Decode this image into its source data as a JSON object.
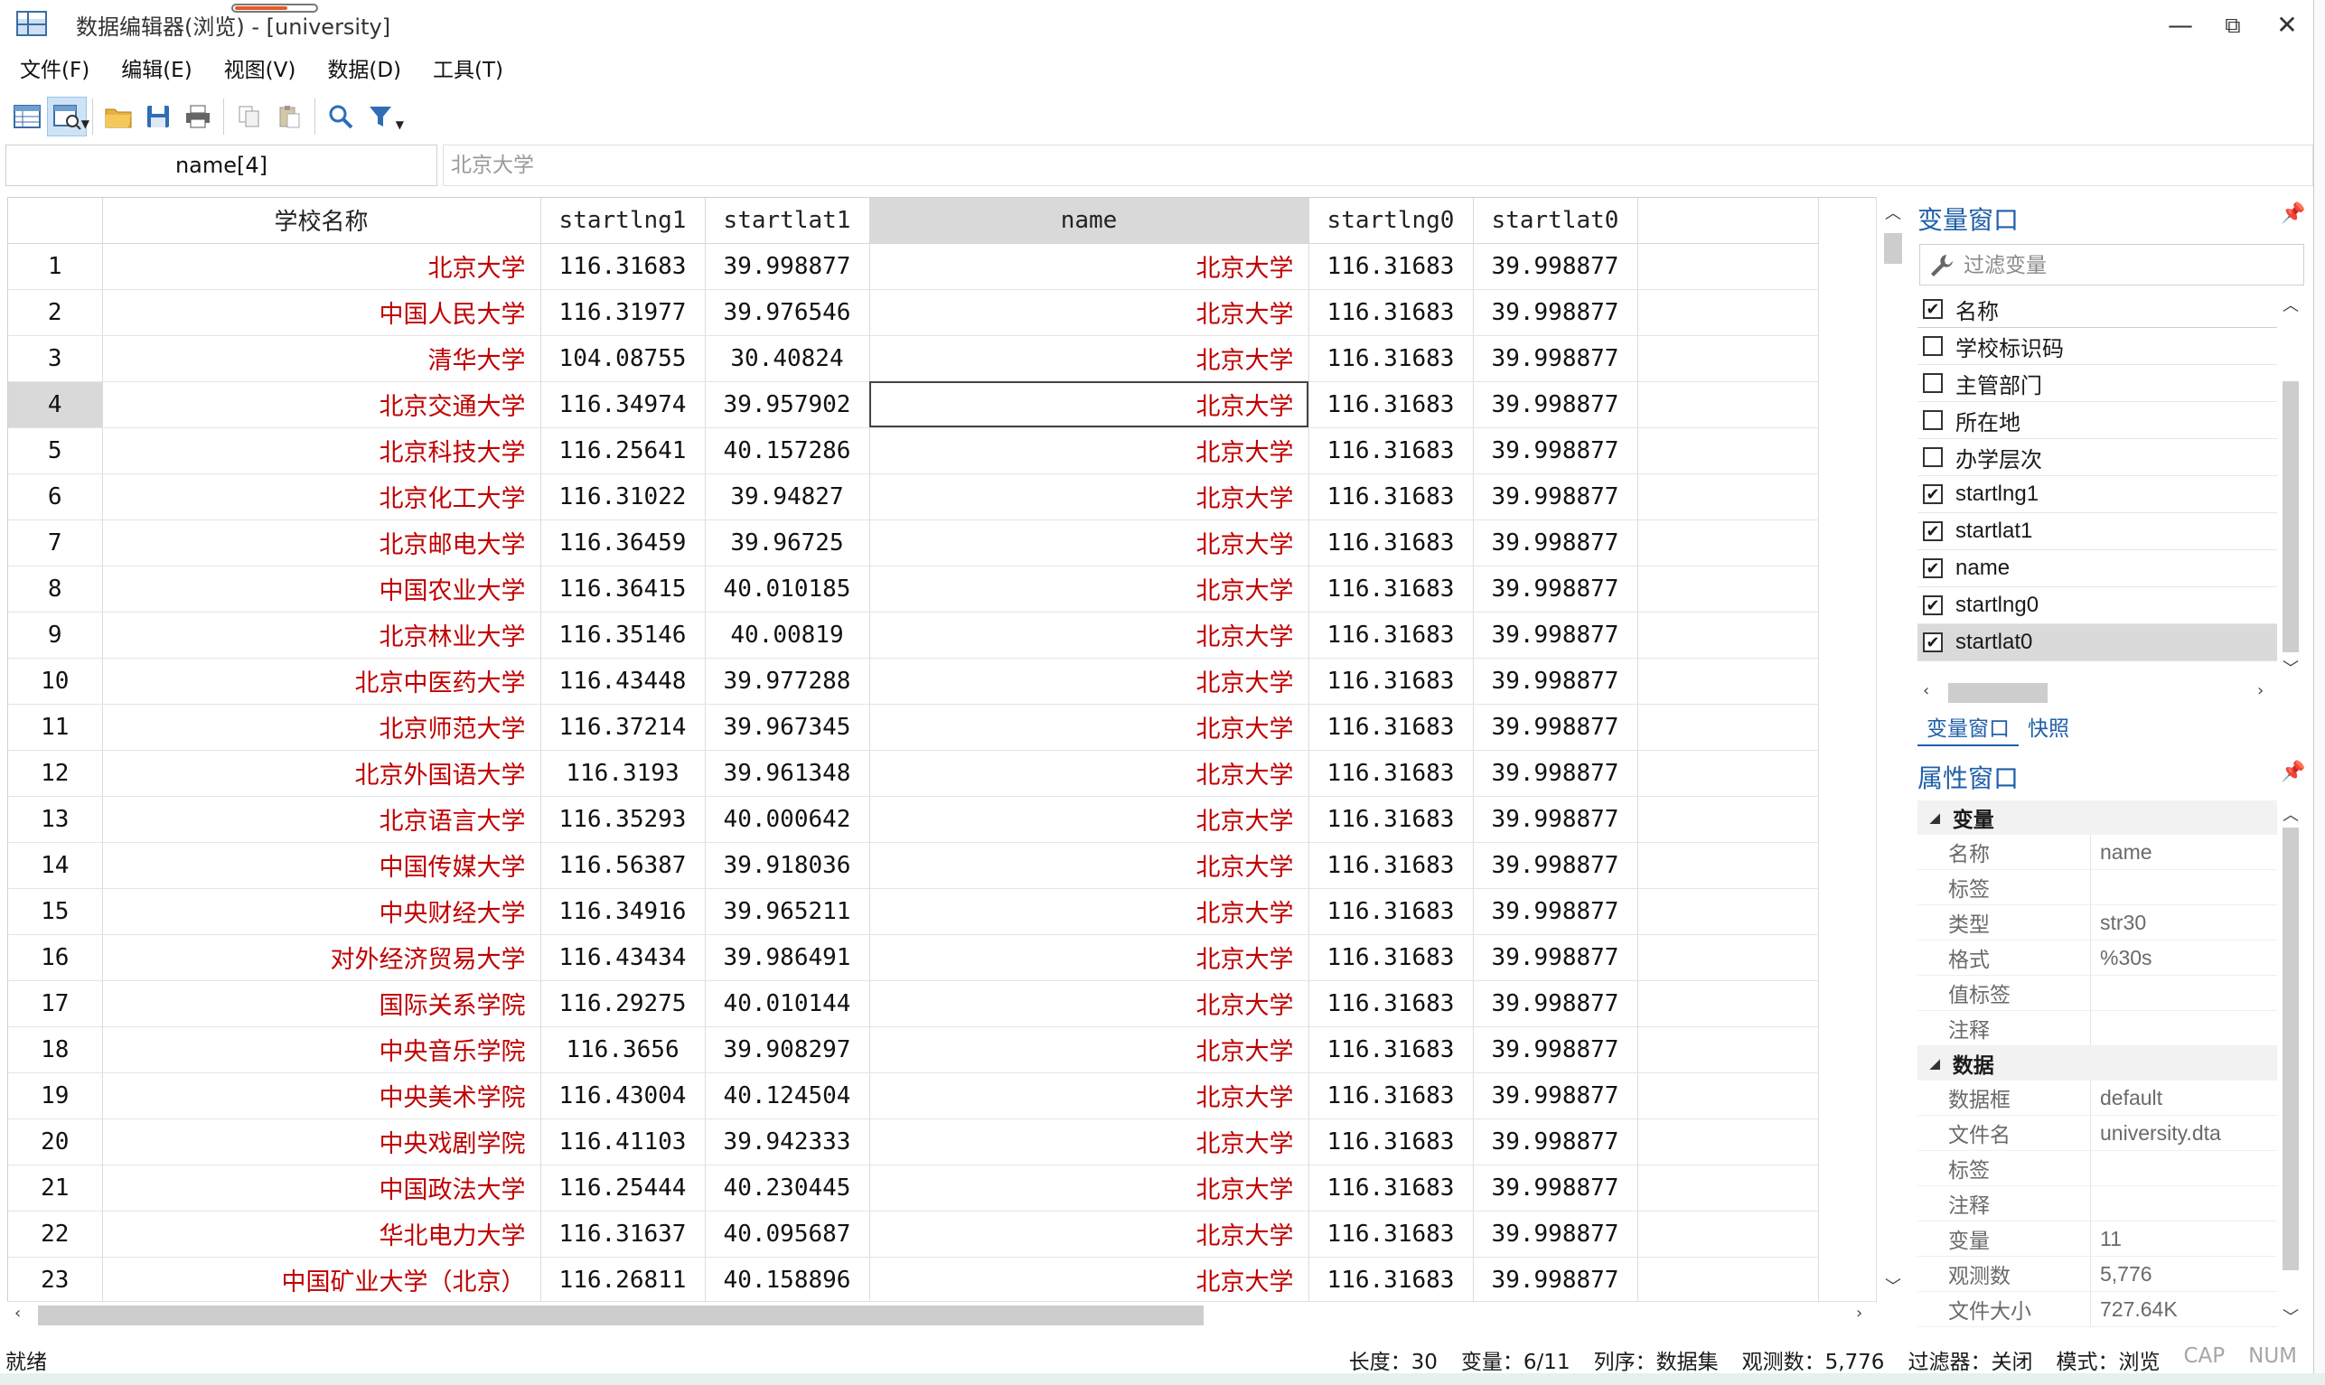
{
  "window": {
    "title": "数据编辑器(浏览) - [university]",
    "minimize": "—",
    "restore": "⧉",
    "close": "✕"
  },
  "menu": [
    "文件(F)",
    "编辑(E)",
    "视图(V)",
    "数据(D)",
    "工具(T)"
  ],
  "toolbar": {
    "icons": [
      "data-editor-edit-icon",
      "data-editor-browse-icon",
      "open-folder-icon",
      "save-icon",
      "print-icon",
      "copy-icon",
      "paste-icon",
      "search-icon",
      "filter-icon"
    ],
    "active": "data-editor-browse-icon"
  },
  "entry": {
    "var_ref": "name[4]",
    "value": "北京大学"
  },
  "grid": {
    "columns": [
      "",
      "学校名称",
      "startlng1",
      "startlat1",
      "name",
      "startlng0",
      "startlat0",
      ""
    ],
    "selected_column": "name",
    "current_row": 4,
    "rows": [
      [
        "1",
        "北京大学",
        "116.31683",
        "39.998877",
        "北京大学",
        "116.31683",
        "39.998877"
      ],
      [
        "2",
        "中国人民大学",
        "116.31977",
        "39.976546",
        "北京大学",
        "116.31683",
        "39.998877"
      ],
      [
        "3",
        "清华大学",
        "104.08755",
        "30.40824",
        "北京大学",
        "116.31683",
        "39.998877"
      ],
      [
        "4",
        "北京交通大学",
        "116.34974",
        "39.957902",
        "北京大学",
        "116.31683",
        "39.998877"
      ],
      [
        "5",
        "北京科技大学",
        "116.25641",
        "40.157286",
        "北京大学",
        "116.31683",
        "39.998877"
      ],
      [
        "6",
        "北京化工大学",
        "116.31022",
        "39.94827",
        "北京大学",
        "116.31683",
        "39.998877"
      ],
      [
        "7",
        "北京邮电大学",
        "116.36459",
        "39.96725",
        "北京大学",
        "116.31683",
        "39.998877"
      ],
      [
        "8",
        "中国农业大学",
        "116.36415",
        "40.010185",
        "北京大学",
        "116.31683",
        "39.998877"
      ],
      [
        "9",
        "北京林业大学",
        "116.35146",
        "40.00819",
        "北京大学",
        "116.31683",
        "39.998877"
      ],
      [
        "10",
        "北京中医药大学",
        "116.43448",
        "39.977288",
        "北京大学",
        "116.31683",
        "39.998877"
      ],
      [
        "11",
        "北京师范大学",
        "116.37214",
        "39.967345",
        "北京大学",
        "116.31683",
        "39.998877"
      ],
      [
        "12",
        "北京外国语大学",
        "116.3193",
        "39.961348",
        "北京大学",
        "116.31683",
        "39.998877"
      ],
      [
        "13",
        "北京语言大学",
        "116.35293",
        "40.000642",
        "北京大学",
        "116.31683",
        "39.998877"
      ],
      [
        "14",
        "中国传媒大学",
        "116.56387",
        "39.918036",
        "北京大学",
        "116.31683",
        "39.998877"
      ],
      [
        "15",
        "中央财经大学",
        "116.34916",
        "39.965211",
        "北京大学",
        "116.31683",
        "39.998877"
      ],
      [
        "16",
        "对外经济贸易大学",
        "116.43434",
        "39.986491",
        "北京大学",
        "116.31683",
        "39.998877"
      ],
      [
        "17",
        "国际关系学院",
        "116.29275",
        "40.010144",
        "北京大学",
        "116.31683",
        "39.998877"
      ],
      [
        "18",
        "中央音乐学院",
        "116.3656",
        "39.908297",
        "北京大学",
        "116.31683",
        "39.998877"
      ],
      [
        "19",
        "中央美术学院",
        "116.43004",
        "40.124504",
        "北京大学",
        "116.31683",
        "39.998877"
      ],
      [
        "20",
        "中央戏剧学院",
        "116.41103",
        "39.942333",
        "北京大学",
        "116.31683",
        "39.998877"
      ],
      [
        "21",
        "中国政法大学",
        "116.25444",
        "40.230445",
        "北京大学",
        "116.31683",
        "39.998877"
      ],
      [
        "22",
        "华北电力大学",
        "116.31637",
        "40.095687",
        "北京大学",
        "116.31683",
        "39.998877"
      ],
      [
        "23",
        "中国矿业大学（北京）",
        "116.26811",
        "40.158896",
        "北京大学",
        "116.31683",
        "39.998877"
      ]
    ]
  },
  "variables_panel": {
    "title": "变量窗口",
    "filter_placeholder": "过滤变量",
    "header": "名称",
    "items": [
      {
        "name": "学校标识码",
        "checked": false
      },
      {
        "name": "主管部门",
        "checked": false
      },
      {
        "name": "所在地",
        "checked": false
      },
      {
        "name": "办学层次",
        "checked": false
      },
      {
        "name": "startlng1",
        "checked": true
      },
      {
        "name": "startlat1",
        "checked": true
      },
      {
        "name": "name",
        "checked": true
      },
      {
        "name": "startlng0",
        "checked": true
      },
      {
        "name": "startlat0",
        "checked": true
      }
    ],
    "tabs": [
      "变量窗口",
      "快照"
    ]
  },
  "properties_panel": {
    "title": "属性窗口",
    "groups": [
      {
        "name": "变量",
        "rows": [
          [
            "名称",
            "name"
          ],
          [
            "标签",
            ""
          ],
          [
            "类型",
            "str30"
          ],
          [
            "格式",
            "%30s"
          ],
          [
            "值标签",
            ""
          ],
          [
            "注释",
            ""
          ]
        ]
      },
      {
        "name": "数据",
        "rows": [
          [
            "数据框",
            "default"
          ],
          [
            "文件名",
            "university.dta"
          ],
          [
            "标签",
            ""
          ],
          [
            "注释",
            ""
          ],
          [
            "变量",
            "11"
          ],
          [
            "观测数",
            "5,776"
          ],
          [
            "文件大小",
            "727.64K"
          ]
        ]
      }
    ]
  },
  "status": {
    "left": "就绪",
    "items": [
      "长度：30",
      "变量：6/11",
      "列序：数据集",
      "观测数：5,776",
      "过滤器：关闭",
      "模式：浏览"
    ],
    "dim_items": [
      "CAP",
      "NUM"
    ]
  },
  "colors": {
    "string_cell": "#c00000",
    "panel_title": "#1f5fa8",
    "selected_header": "#d9d9d9"
  }
}
